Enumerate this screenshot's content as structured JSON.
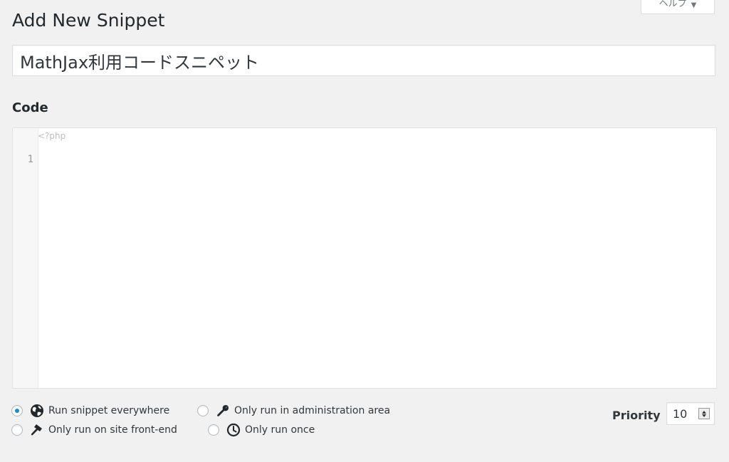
{
  "help_tab": {
    "label": "ヘルプ",
    "caret": "▼"
  },
  "page_title": "Add New Snippet",
  "snippet_title": {
    "value": "MathJax利用コードスニペット"
  },
  "code_section": {
    "heading": "Code",
    "open_tag": "<?php",
    "line_numbers": [
      "1"
    ]
  },
  "scope_options": [
    {
      "label": "Run snippet everywhere",
      "icon": "globe-icon",
      "checked": true
    },
    {
      "label": "Only run in administration area",
      "icon": "wrench-icon",
      "checked": false
    },
    {
      "label": "Only run on site front-end",
      "icon": "hammer-icon",
      "checked": false
    },
    {
      "label": "Only run once",
      "icon": "clock-icon",
      "checked": false
    }
  ],
  "priority": {
    "label": "Priority",
    "value": "10"
  },
  "colors": {
    "accent": "#1e8cbe",
    "background": "#f1f1f1"
  }
}
